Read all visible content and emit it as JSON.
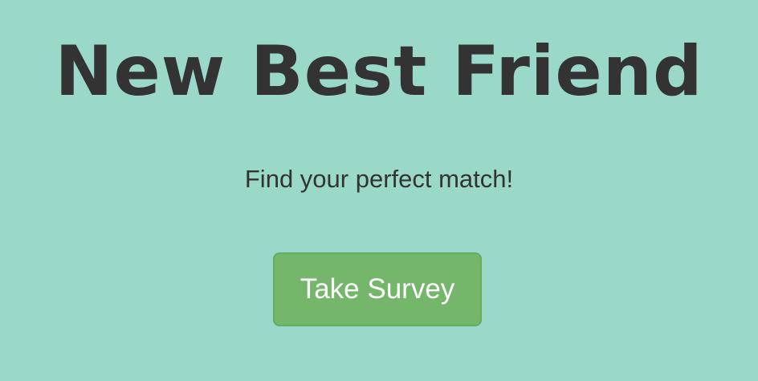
{
  "header": {
    "title": "New Best Friend",
    "subtitle": "Find your perfect match!"
  },
  "actions": {
    "survey_button_label": "Take Survey"
  },
  "colors": {
    "background": "#9ad8c9",
    "text": "#333333",
    "button": "#74b66a",
    "button_border": "#68ad5f",
    "button_text": "#ffffff"
  }
}
